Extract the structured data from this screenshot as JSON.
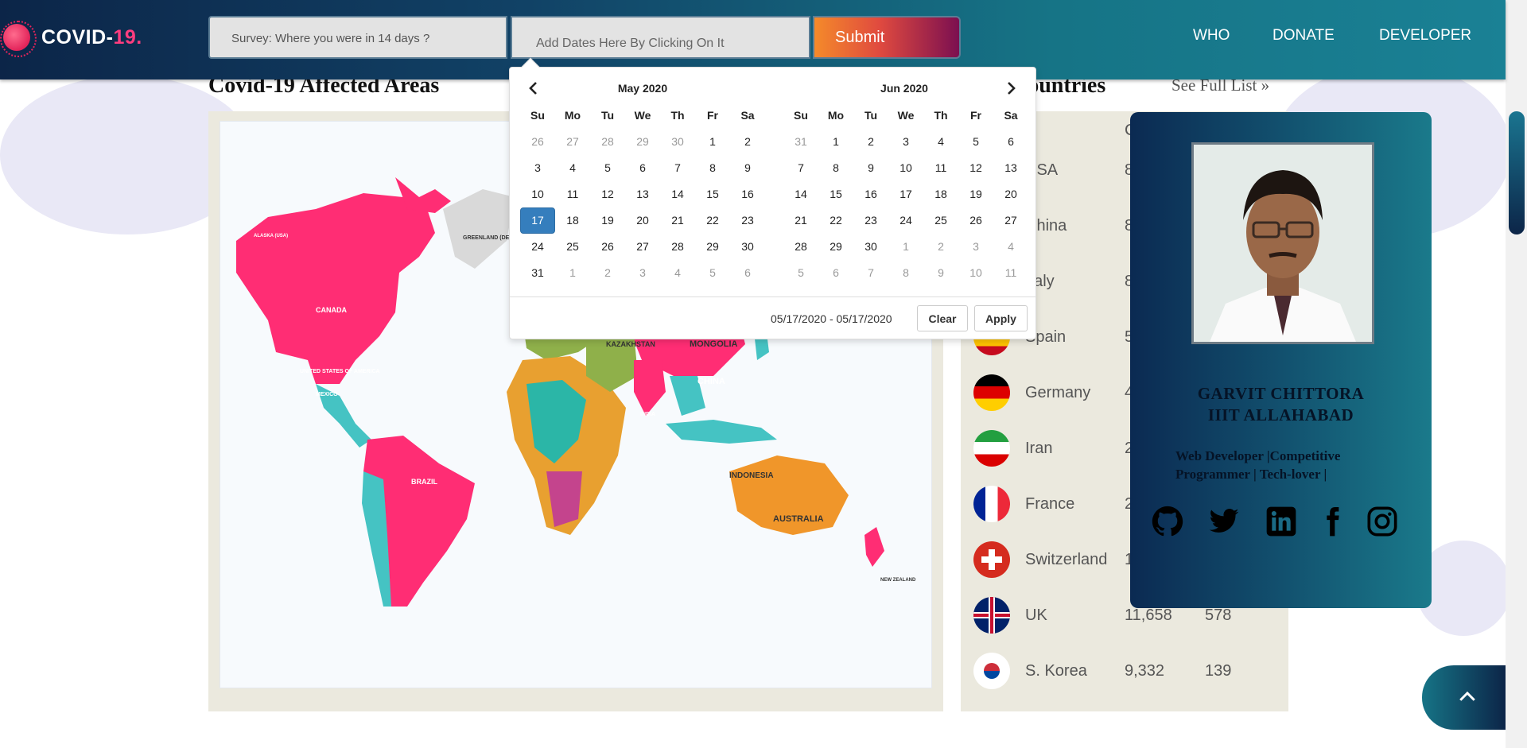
{
  "header": {
    "logo_text_main": "COVID-",
    "logo_text_accent": "19.",
    "survey_label": "Survey:  Where you were in 14 days ?",
    "dates_value": "Add Dates Here By Clicking On It",
    "submit_label": "Submit",
    "nav": [
      "WHO",
      "DONATE",
      "DEVELOPER"
    ]
  },
  "map_section": {
    "title": "Covid-19 Affected Areas",
    "labels": {
      "alaska": "ALASKA (USA)",
      "canada": "CANADA",
      "usa": "UNITED STATES OF AMERICA",
      "mexico": "MEXICO",
      "greenland": "GREENLAND (DENMARK)",
      "brazil": "BRAZIL",
      "kazakhstan": "KAZAKHSTAN",
      "mongolia": "MONGOLIA",
      "china": "CHINA",
      "india": "INDIA",
      "indonesia": "INDONESIA",
      "australia": "AUSTRALIA",
      "nz": "NEW ZEALAND"
    }
  },
  "countries_section": {
    "title": "10 Countries",
    "see_full": "See Full List  »",
    "col_header": "C",
    "rows": [
      {
        "name": "USA",
        "cases": "8",
        "deaths": ""
      },
      {
        "name": "China",
        "cases": "8",
        "deaths": ""
      },
      {
        "name": "Italy",
        "cases": "8",
        "deaths": ""
      },
      {
        "name": "Spain",
        "cases": "5",
        "deaths": ""
      },
      {
        "name": "Germany",
        "cases": "4",
        "deaths": ""
      },
      {
        "name": "Iran",
        "cases": "2",
        "deaths": ""
      },
      {
        "name": "France",
        "cases": "2",
        "deaths": ""
      },
      {
        "name": "Switzerland",
        "cases": "1",
        "deaths": ""
      },
      {
        "name": "UK",
        "cases": "11,658",
        "deaths": "578"
      },
      {
        "name": "S. Korea",
        "cases": "9,332",
        "deaths": "139"
      }
    ]
  },
  "developer": {
    "name_line1": "GARVIT CHITTORA",
    "name_line2": "IIIT ALLAHABAD",
    "desc": "Web Developer |Competitive Programmer | Tech-lover |",
    "social": [
      "github-icon",
      "twitter-icon",
      "linkedin-icon",
      "facebook-icon",
      "instagram-icon"
    ]
  },
  "calendar": {
    "left_month": "May 2020",
    "right_month": "Jun 2020",
    "weekdays": [
      "Su",
      "Mo",
      "Tu",
      "We",
      "Th",
      "Fr",
      "Sa"
    ],
    "left_days": [
      [
        "26",
        "27",
        "28",
        "29",
        "30",
        "1",
        "2"
      ],
      [
        "3",
        "4",
        "5",
        "6",
        "7",
        "8",
        "9"
      ],
      [
        "10",
        "11",
        "12",
        "13",
        "14",
        "15",
        "16"
      ],
      [
        "17",
        "18",
        "19",
        "20",
        "21",
        "22",
        "23"
      ],
      [
        "24",
        "25",
        "26",
        "27",
        "28",
        "29",
        "30"
      ],
      [
        "31",
        "1",
        "2",
        "3",
        "4",
        "5",
        "6"
      ]
    ],
    "right_days": [
      [
        "31",
        "1",
        "2",
        "3",
        "4",
        "5",
        "6"
      ],
      [
        "7",
        "8",
        "9",
        "10",
        "11",
        "12",
        "13"
      ],
      [
        "14",
        "15",
        "16",
        "17",
        "18",
        "19",
        "20"
      ],
      [
        "21",
        "22",
        "23",
        "24",
        "25",
        "26",
        "27"
      ],
      [
        "28",
        "29",
        "30",
        "1",
        "2",
        "3",
        "4"
      ],
      [
        "5",
        "6",
        "7",
        "8",
        "9",
        "10",
        "11"
      ]
    ],
    "selected_day": "17",
    "range_text": "05/17/2020 - 05/17/2020",
    "clear_label": "Clear",
    "apply_label": "Apply"
  },
  "colors": {
    "accent": "#ff3d7f",
    "header_start": "#0c2548",
    "header_end": "#1a8195",
    "selected_day": "#357ebd"
  }
}
